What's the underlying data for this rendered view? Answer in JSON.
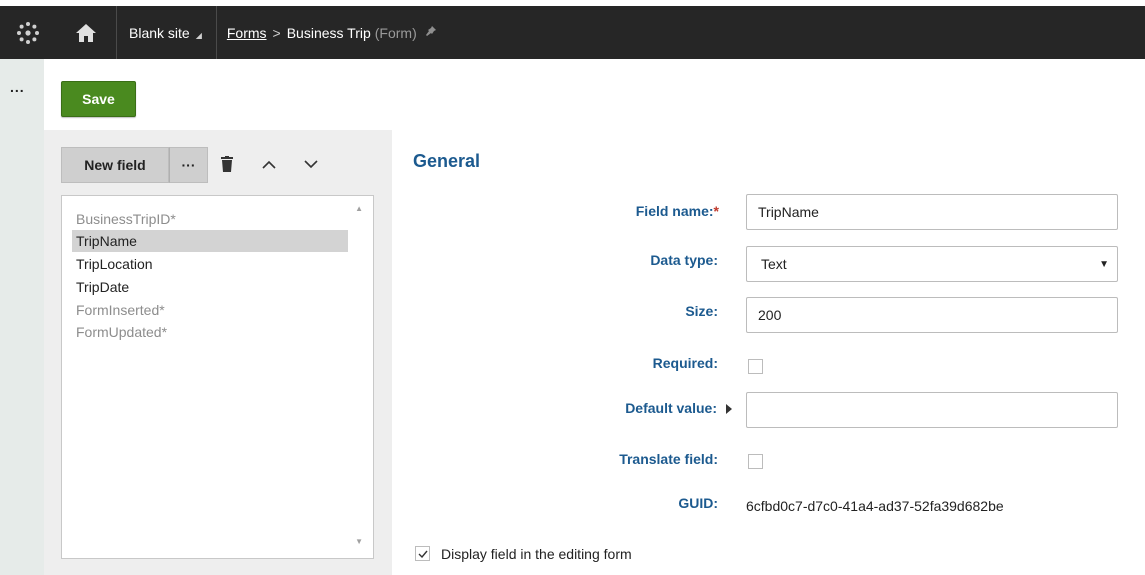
{
  "header": {
    "site_label": "Blank site",
    "breadcrumb_link": "Forms",
    "breadcrumb_separator": ">",
    "breadcrumb_current": "Business Trip",
    "breadcrumb_type": "(Form)",
    "icons": [
      "app-logo-icon",
      "home-icon",
      "site-dropdown-icon",
      "pin-icon"
    ]
  },
  "side_strip": {
    "more_label": "..."
  },
  "toolbar": {
    "save_label": "Save"
  },
  "field_tools": {
    "new_field_label": "New field",
    "more_label": "···",
    "icons": [
      "trash-icon",
      "chevron-up-icon",
      "chevron-down-icon"
    ]
  },
  "fields": [
    {
      "label": "BusinessTripID*",
      "system": true,
      "selected": false
    },
    {
      "label": "TripName",
      "system": false,
      "selected": true
    },
    {
      "label": "TripLocation",
      "system": false,
      "selected": false
    },
    {
      "label": "TripDate",
      "system": false,
      "selected": false
    },
    {
      "label": "FormInserted*",
      "system": true,
      "selected": false
    },
    {
      "label": "FormUpdated*",
      "system": true,
      "selected": false
    }
  ],
  "general": {
    "title": "General",
    "field_name_label": "Field name:",
    "field_name_required_mark": "*",
    "field_name_value": "TripName",
    "data_type_label": "Data type:",
    "data_type_value": "Text",
    "size_label": "Size:",
    "size_value": "200",
    "required_label": "Required:",
    "required_checked": false,
    "default_value_label": "Default value:",
    "default_value_value": "",
    "translate_label": "Translate field:",
    "translate_checked": false,
    "guid_label": "GUID:",
    "guid_value": "6cfbd0c7-d7c0-41a4-ad37-52fa39d682be",
    "display_label": "Display field in the editing form",
    "display_checked": true
  },
  "colors": {
    "topbar": "#262626",
    "save_button": "#4a8a1f",
    "label_blue": "#1c5a8f",
    "required_red": "#c0392b"
  }
}
